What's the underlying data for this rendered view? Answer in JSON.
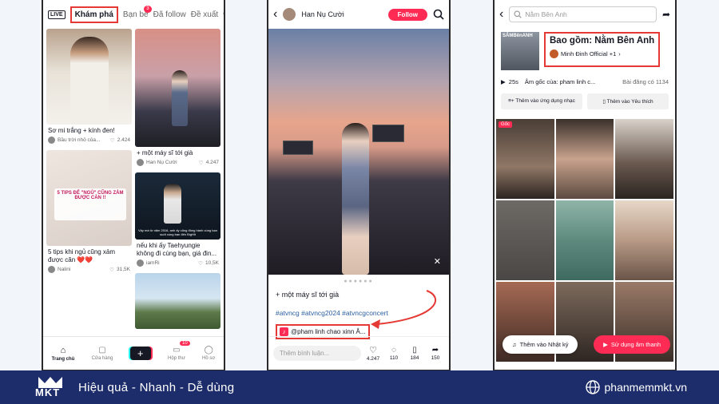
{
  "screen1": {
    "tabs": [
      "Khám phá",
      "Bạn bè",
      "Đã follow",
      "Đề xuất"
    ],
    "friends_badge": "3",
    "cards": [
      {
        "title": "Sơ mi trắng + kính đen!",
        "author": "Bầu trời nhỏ của...",
        "likes": "2.424"
      },
      {
        "title": "+ một máy sĩ tới già",
        "author": "Han Nụ Cười",
        "likes": "4.247"
      },
      {
        "title": "5 tips khi ngủ cũng xảm được căn ❤️❤️",
        "author": "Nalini",
        "likes": "31,5K"
      },
      {
        "title": "nếu khi ấy Taehyungie không đi cùng bạn, giá đin...",
        "author": "iamRi",
        "likes": "10,5K"
      }
    ],
    "overlay_caption": "5 TIPS ĐỂ \"NGỦ\" CŨNG ZẢM ĐƯỢC CĂN !!",
    "subtitle_caption": "Vậy mà từ năm 2016, anh ấy cũng đồng hành cùng bạn suốt cùng bạn đến BigHit",
    "nav": [
      "Trang chủ",
      "Cửa hàng",
      "",
      "Hộp thư",
      "Hồ sơ"
    ],
    "inbox_badge": "10"
  },
  "screen2": {
    "username": "Han Nụ Cười",
    "follow_label": "Follow",
    "caption": "+ một máy sĩ tới già",
    "hashtags": "#atvncg #atvncg2024 #atvncgconcert",
    "music": "@pham linh chao xinn Â...",
    "comment_placeholder": "Thêm bình luận...",
    "stats": {
      "likes": "4.247",
      "comments": "110",
      "saves": "184",
      "shares": "150"
    }
  },
  "screen3": {
    "search_placeholder": "Nằm Bên Anh",
    "sound_title": "Bao gồm: Nằm Bên Anh",
    "artist": "Minh Đinh Official +1",
    "album_text": "SÂMBênANH",
    "duration": "25s",
    "origin": "Âm gốc của: pham linh c...",
    "posts": "Bài đăng có 1134",
    "add_app": "Thêm vào ứng dụng nhạc",
    "add_fav": "Thêm vào Yêu thích",
    "original_tag": "Gốc",
    "diary_btn": "Thêm vào Nhật ký",
    "use_sound_btn": "Sử dụng âm thanh"
  },
  "footer": {
    "brand": "MKT",
    "slogan": "Hiệu quả - Nhanh - Dễ dùng",
    "website": "phanmemmkt.vn"
  },
  "colors": {
    "accent": "#fe2c55",
    "highlight": "#e53935",
    "footer_bg": "#1d2d6b"
  }
}
